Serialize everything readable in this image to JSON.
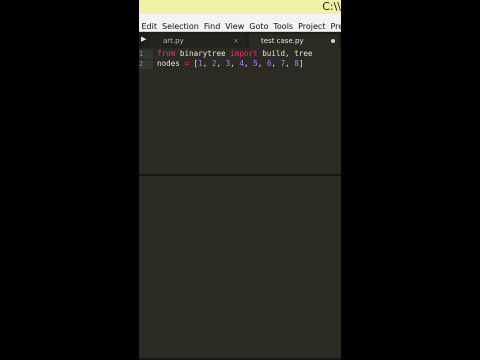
{
  "window": {
    "title_path": "C:\\\\"
  },
  "menubar": {
    "items": [
      "Edit",
      "Selection",
      "Find",
      "View",
      "Goto",
      "Tools",
      "Project",
      "Prefere"
    ]
  },
  "tabs": [
    {
      "label": "art.py",
      "close": "×",
      "active": false
    },
    {
      "label": "test case.py",
      "active": true
    }
  ],
  "nav": {
    "arrow": "▶"
  },
  "editor": {
    "line_numbers": [
      "1",
      "2"
    ],
    "line1": {
      "kw_from": "from",
      "module": "binarytree",
      "kw_import": "import",
      "names": "build, tree"
    },
    "line2": {
      "var": "nodes",
      "op": "=",
      "open": "[",
      "values": [
        "1",
        "2",
        "3",
        "4",
        "5",
        "6",
        "7",
        "8"
      ],
      "close": "]"
    }
  }
}
